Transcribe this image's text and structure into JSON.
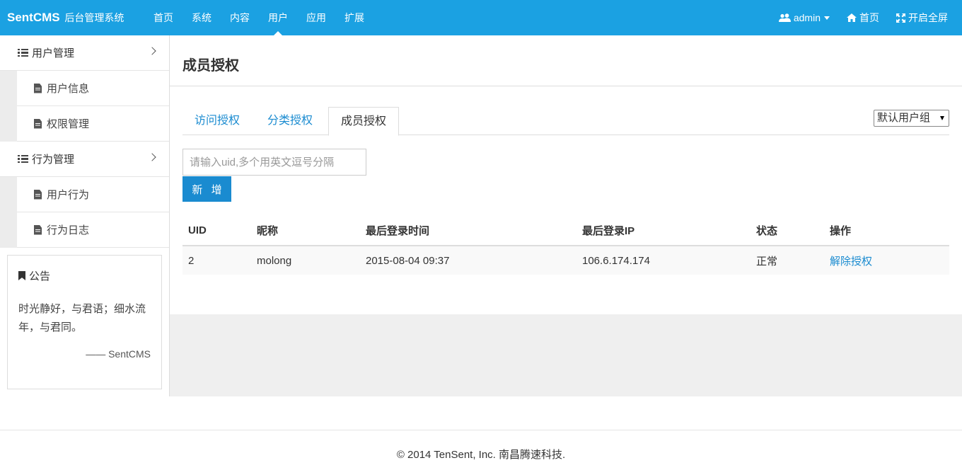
{
  "brand": {
    "name": "SentCMS",
    "subtitle": "后台管理系统"
  },
  "nav": [
    "首页",
    "系统",
    "内容",
    "用户",
    "应用",
    "扩展"
  ],
  "nav_active": "用户",
  "topright": {
    "user": "admin",
    "home": "首页",
    "fullscreen": "开启全屏"
  },
  "sidebar": {
    "groups": [
      {
        "label": "用户管理",
        "items": [
          "用户信息",
          "权限管理"
        ]
      },
      {
        "label": "行为管理",
        "items": [
          "用户行为",
          "行为日志"
        ]
      }
    ],
    "notice": {
      "title": "公告",
      "body": "时光静好，与君语；细水流年，与君同。",
      "signature": "—— SentCMS"
    }
  },
  "main": {
    "title": "成员授权",
    "tabs": [
      "访问授权",
      "分类授权",
      "成员授权"
    ],
    "active_tab": "成员授权",
    "group_select": "默认用户组",
    "uid_input": {
      "value": "",
      "placeholder": "请输入uid,多个用英文逗号分隔"
    },
    "add_button": "新 增",
    "table": {
      "headers": [
        "UID",
        "昵称",
        "最后登录时间",
        "最后登录IP",
        "状态",
        "操作"
      ],
      "rows": [
        {
          "uid": "2",
          "nickname": "molong",
          "last_login": "2015-08-04 09:37",
          "last_ip": "106.6.174.174",
          "status": "正常",
          "action": "解除授权"
        }
      ]
    }
  },
  "footer": "© 2014 TenSent, Inc. 南昌腾速科技.",
  "colors": {
    "topbar": "#1ba1e2",
    "accent": "#1a8bd0"
  }
}
